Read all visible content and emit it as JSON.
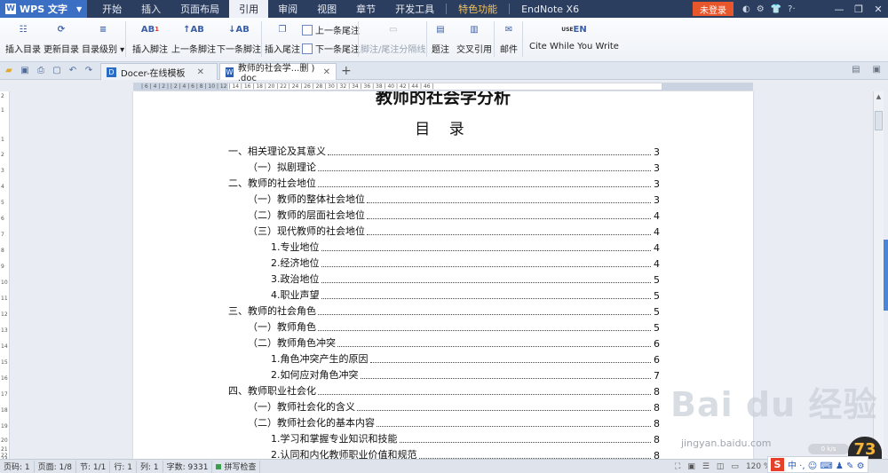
{
  "menubar": {
    "app_name": "WPS 文字",
    "items": [
      "开始",
      "插入",
      "页面布局",
      "引用",
      "审阅",
      "视图",
      "章节",
      "开发工具",
      "特色功能",
      "EndNote X6"
    ],
    "active_index": 3,
    "login": "未登录",
    "top_icons": [
      "skin-icon",
      "gear-icon",
      "shirt-icon",
      "help-icon"
    ],
    "win_controls": [
      "minimize-icon",
      "restore-icon",
      "close-icon"
    ],
    "accent": "#3b6fc4",
    "login_color": "#e8572c"
  },
  "ribbon": {
    "insert_toc": "插入目录",
    "update_toc": "更新目录",
    "toc_level": "目录级别",
    "insert_footnote": "插入脚注",
    "prev_footnote": "上一条脚注",
    "next_footnote": "下一条脚注",
    "insert_endnote": "插入尾注",
    "prev_endnote": "上一条尾注",
    "next_endnote": "下一条尾注",
    "separator": "脚注/尾注分隔线",
    "caption": "题注",
    "cross_ref": "交叉引用",
    "mail": "邮件",
    "cwyw": "Cite While You Write",
    "en_logo": "EN",
    "en_sup": "USE",
    "ab_icon": "AB",
    "ab_sup": "1"
  },
  "tabs": {
    "tab1": "Docer-在线模板",
    "tab2": "教师的社会学...删 ) .doc",
    "doc_icon": "W"
  },
  "ruler": "| 6 | 4 | 2 |   | 2 | 4 | 6 | 8 | 10 | 12 | 14 | 16 | 18 | 20 | 22 | 24 | 26 | 28 | 30 | 32 | 34 | 36 | 38 |   40 | 42 | 44 | 46 |",
  "vruler": [
    "2",
    "1",
    "1",
    "2",
    "3",
    "4",
    "5",
    "6",
    "7",
    "8",
    "9",
    "10",
    "11",
    "12",
    "13",
    "14",
    "15",
    "16",
    "17",
    "18",
    "19",
    "20",
    "21",
    "22",
    "23"
  ],
  "document": {
    "title": "教师的社会学分析",
    "toc_heading": "目 录",
    "toc": [
      {
        "text": "一、相关理论及其意义",
        "page": "3",
        "level": 1
      },
      {
        "text": "（一）拟剧理论",
        "page": "3",
        "level": 2
      },
      {
        "text": "二、教师的社会地位",
        "page": "3",
        "level": 1
      },
      {
        "text": "（一）教师的整体社会地位",
        "page": "3",
        "level": 2
      },
      {
        "text": "（二）教师的层面社会地位",
        "page": "4",
        "level": 2
      },
      {
        "text": "（三）现代教师的社会地位",
        "page": "4",
        "level": 2
      },
      {
        "text": "1.专业地位",
        "page": "4",
        "level": 3
      },
      {
        "text": "2.经济地位",
        "page": "4",
        "level": 3
      },
      {
        "text": "3.政治地位",
        "page": "5",
        "level": 3
      },
      {
        "text": "4.职业声望",
        "page": "5",
        "level": 3
      },
      {
        "text": "三、教师的社会角色",
        "page": "5",
        "level": 1
      },
      {
        "text": "（一）教师角色",
        "page": "5",
        "level": 2
      },
      {
        "text": "（二）教师角色冲突",
        "page": "6",
        "level": 2
      },
      {
        "text": "1.角色冲突产生的原因",
        "page": "6",
        "level": 3
      },
      {
        "text": "2.如何应对角色冲突",
        "page": "7",
        "level": 3
      },
      {
        "text": "四、教师职业社会化",
        "page": "8",
        "level": 1
      },
      {
        "text": "（一）教师社会化的含义",
        "page": "8",
        "level": 2
      },
      {
        "text": "（二）教师社会化的基本内容",
        "page": "8",
        "level": 2
      },
      {
        "text": "1.学习和掌握专业知识和技能",
        "page": "8",
        "level": 3
      },
      {
        "text": "2.认同和内化教师职业价值和规范",
        "page": "8",
        "level": 3
      }
    ]
  },
  "status": {
    "page_code": "页码: 1",
    "page": "页面: 1/8",
    "section": "节: 1/1",
    "row": "行: 1",
    "col": "列: 1",
    "words": "字数: 9331",
    "spell": "拼写检查",
    "zoom": "120 %"
  },
  "watermark": {
    "brand": "Bai  du 经验",
    "url": "jingyan.baidu.com",
    "badge": "73",
    "bubble": "0 k/s"
  },
  "ime": {
    "logo": "S",
    "text": "中 ·, ☺ ⌨ ♟ ✎ ⚙"
  }
}
